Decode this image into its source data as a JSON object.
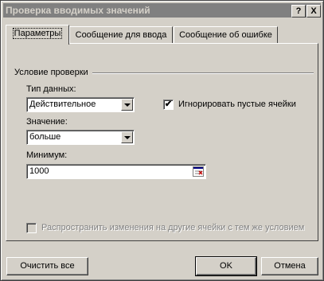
{
  "window": {
    "title": "Проверка вводимых значений",
    "help_label": "?",
    "close_label": "X"
  },
  "tabs": [
    {
      "label": "Параметры",
      "active": true
    },
    {
      "label": "Сообщение для ввода",
      "active": false
    },
    {
      "label": "Сообщение об ошибке",
      "active": false
    }
  ],
  "group": {
    "title": "Условие проверки"
  },
  "data_type": {
    "label": "Тип данных:",
    "value": "Действительное"
  },
  "ignore_blank": {
    "label": "Игнорировать пустые ячейки",
    "checked": true
  },
  "operator": {
    "label": "Значение:",
    "value": "больше"
  },
  "minimum": {
    "label": "Минимум:",
    "value": "1000"
  },
  "apply_all": {
    "label": "Распространить изменения на другие ячейки с тем же условием",
    "checked": false,
    "enabled": false
  },
  "buttons": {
    "clear_all": "Очистить все",
    "ok": "OK",
    "cancel": "Отмена"
  }
}
